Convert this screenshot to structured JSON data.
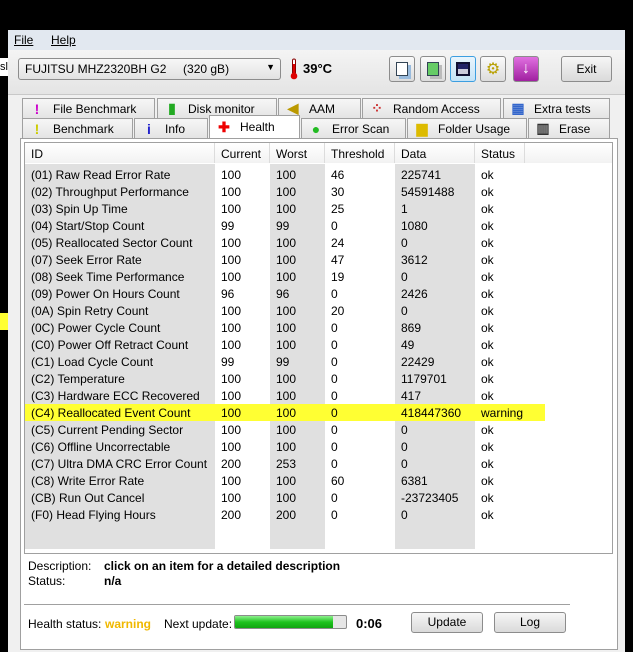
{
  "background_fragment": "esl",
  "menu": {
    "file": "File",
    "help": "Help"
  },
  "toolbar": {
    "drive": "FUJITSU MHZ2320BH G2     (320 gB)",
    "temperature": "39°C",
    "exit": "Exit",
    "buttons": [
      "copy-text-icon",
      "copy-screenshot-icon",
      "save-icon",
      "options-icon",
      "download-icon"
    ]
  },
  "tabs_row1": [
    {
      "label": "File Benchmark",
      "icon": "file-benchmark-icon"
    },
    {
      "label": "Disk monitor",
      "icon": "disk-monitor-icon"
    },
    {
      "label": "AAM",
      "icon": "speaker-icon"
    },
    {
      "label": "Random Access",
      "icon": "random-access-icon"
    },
    {
      "label": "Extra tests",
      "icon": "extra-tests-icon"
    }
  ],
  "tabs_row2": [
    {
      "label": "Benchmark",
      "icon": "exclamation-icon"
    },
    {
      "label": "Info",
      "icon": "info-icon"
    },
    {
      "label": "Health",
      "icon": "red-cross-icon",
      "selected": true
    },
    {
      "label": "Error Scan",
      "icon": "magnifier-icon"
    },
    {
      "label": "Folder Usage",
      "icon": "folder-icon"
    },
    {
      "label": "Erase",
      "icon": "trash-icon"
    }
  ],
  "table": {
    "columns": [
      "ID",
      "Current",
      "Worst",
      "Threshold",
      "Data",
      "Status"
    ],
    "rows": [
      [
        "(01) Raw Read Error Rate",
        "100",
        "100",
        "46",
        "225741",
        "ok"
      ],
      [
        "(02) Throughput Performance",
        "100",
        "100",
        "30",
        "54591488",
        "ok"
      ],
      [
        "(03) Spin Up Time",
        "100",
        "100",
        "25",
        "1",
        "ok"
      ],
      [
        "(04) Start/Stop Count",
        "99",
        "99",
        "0",
        "1080",
        "ok"
      ],
      [
        "(05) Reallocated Sector Count",
        "100",
        "100",
        "24",
        "0",
        "ok"
      ],
      [
        "(07) Seek Error Rate",
        "100",
        "100",
        "47",
        "3612",
        "ok"
      ],
      [
        "(08) Seek Time Performance",
        "100",
        "100",
        "19",
        "0",
        "ok"
      ],
      [
        "(09) Power On Hours Count",
        "96",
        "96",
        "0",
        "2426",
        "ok"
      ],
      [
        "(0A) Spin Retry Count",
        "100",
        "100",
        "20",
        "0",
        "ok"
      ],
      [
        "(0C) Power Cycle Count",
        "100",
        "100",
        "0",
        "869",
        "ok"
      ],
      [
        "(C0) Power Off Retract Count",
        "100",
        "100",
        "0",
        "49",
        "ok"
      ],
      [
        "(C1) Load Cycle Count",
        "99",
        "99",
        "0",
        "22429",
        "ok"
      ],
      [
        "(C2) Temperature",
        "100",
        "100",
        "0",
        "1179701",
        "ok"
      ],
      [
        "(C3) Hardware ECC Recovered",
        "100",
        "100",
        "0",
        "417",
        "ok"
      ],
      [
        "(C4) Reallocated Event Count",
        "100",
        "100",
        "0",
        "418447360",
        "warning"
      ],
      [
        "(C5) Current Pending Sector",
        "100",
        "100",
        "0",
        "0",
        "ok"
      ],
      [
        "(C6) Offline Uncorrectable",
        "100",
        "100",
        "0",
        "0",
        "ok"
      ],
      [
        "(C7) Ultra DMA CRC Error Count",
        "200",
        "253",
        "0",
        "0",
        "ok"
      ],
      [
        "(C8) Write Error Rate",
        "100",
        "100",
        "60",
        "6381",
        "ok"
      ],
      [
        "(CB) Run Out Cancel",
        "100",
        "100",
        "0",
        "-23723405",
        "ok"
      ],
      [
        "(F0) Head Flying Hours",
        "200",
        "200",
        "0",
        "0",
        "ok"
      ]
    ],
    "warning_highlight": "#ffff33"
  },
  "details": {
    "description_label": "Description:",
    "description": "click on an item for a detailed description",
    "status_label": "Status:",
    "status": "n/a"
  },
  "footer": {
    "health_label": "Health status:",
    "health": "warning",
    "health_color": "#f0b800",
    "next_label": "Next update:",
    "progress": 0.88,
    "timer": "0:06",
    "update": "Update",
    "log": "Log"
  }
}
